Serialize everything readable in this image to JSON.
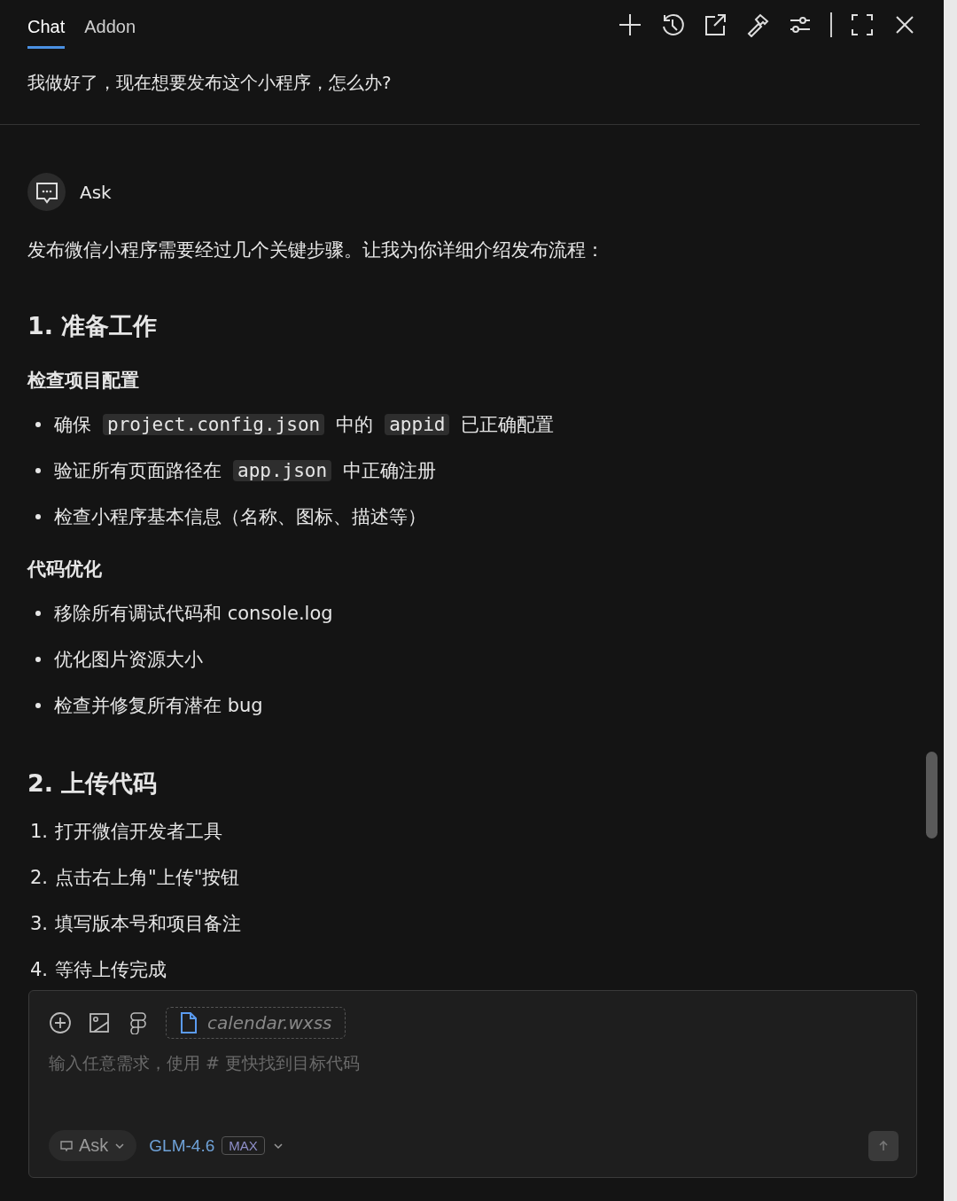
{
  "tabs": [
    {
      "label": "Chat",
      "selected": true
    },
    {
      "label": "Addon",
      "selected": false
    }
  ],
  "user_message": "我做好了，现在想要发布这个小程序，怎么办?",
  "response": {
    "mode_label": "Ask",
    "intro": "发布微信小程序需要经过几个关键步骤。让我为你详细介绍发布流程：",
    "sections": [
      {
        "heading": "1. 准备工作",
        "blocks": [
          {
            "kind": "subheading",
            "text": "检查项目配置"
          },
          {
            "kind": "bullet",
            "segments": [
              {
                "text": "确保",
                "code": false
              },
              {
                "text": "project.config.json",
                "code": true
              },
              {
                "text": "中的",
                "code": false
              },
              {
                "text": "appid",
                "code": true
              },
              {
                "text": "已正确配置",
                "code": false
              }
            ]
          },
          {
            "kind": "bullet",
            "segments": [
              {
                "text": "验证所有页面路径在",
                "code": false
              },
              {
                "text": "app.json",
                "code": true
              },
              {
                "text": "中正确注册",
                "code": false
              }
            ]
          },
          {
            "kind": "bullet",
            "segments": [
              {
                "text": "检查小程序基本信息（名称、图标、描述等）",
                "code": false
              }
            ]
          },
          {
            "kind": "subheading",
            "text": "代码优化"
          },
          {
            "kind": "bullet",
            "segments": [
              {
                "text": "移除所有调试代码和 console.log",
                "code": false
              }
            ]
          },
          {
            "kind": "bullet",
            "segments": [
              {
                "text": "优化图片资源大小",
                "code": false
              }
            ]
          },
          {
            "kind": "bullet",
            "segments": [
              {
                "text": "检查并修复所有潜在 bug",
                "code": false
              }
            ]
          }
        ]
      },
      {
        "heading": "2. 上传代码",
        "blocks": [
          {
            "kind": "numbered",
            "marker": "1.",
            "segments": [
              {
                "text": "打开微信开发者工具",
                "code": false
              }
            ]
          },
          {
            "kind": "numbered",
            "marker": "2.",
            "segments": [
              {
                "text": "点击右上角\"上传\"按钮",
                "code": false
              }
            ]
          },
          {
            "kind": "numbered",
            "marker": "3.",
            "segments": [
              {
                "text": "填写版本号和项目备注",
                "code": false
              }
            ]
          },
          {
            "kind": "numbered",
            "marker": "4.",
            "segments": [
              {
                "text": "等待上传完成",
                "code": false
              }
            ]
          }
        ]
      }
    ]
  },
  "composer": {
    "attachment": "calendar.wxss",
    "placeholder": "输入任意需求，使用 # 更快找到目标代码",
    "mode": "Ask",
    "model": "GLM-4.6",
    "model_badge": "MAX"
  }
}
